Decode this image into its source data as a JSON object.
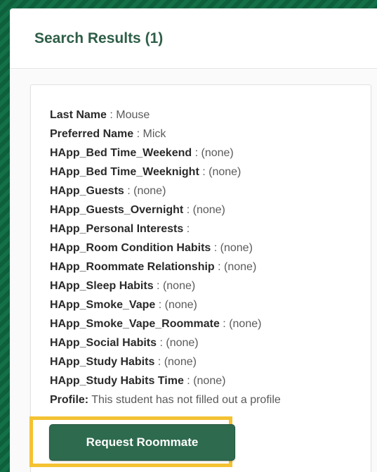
{
  "panel": {
    "title": "Search Results (1)"
  },
  "result": {
    "fields": [
      {
        "label": "Last Name",
        "sep": " : ",
        "value": "Mouse"
      },
      {
        "label": "Preferred Name",
        "sep": " : ",
        "value": "Mick"
      },
      {
        "label": "HApp_Bed Time_Weekend",
        "sep": " : ",
        "value": "(none)"
      },
      {
        "label": "HApp_Bed Time_Weeknight",
        "sep": " : ",
        "value": "(none)"
      },
      {
        "label": "HApp_Guests",
        "sep": " : ",
        "value": "(none)"
      },
      {
        "label": "HApp_Guests_Overnight",
        "sep": " : ",
        "value": "(none)"
      },
      {
        "label": "HApp_Personal Interests",
        "sep": " : ",
        "value": ""
      },
      {
        "label": "HApp_Room Condition Habits",
        "sep": " : ",
        "value": "(none)"
      },
      {
        "label": "HApp_Roommate Relationship",
        "sep": " : ",
        "value": "(none)"
      },
      {
        "label": "HApp_Sleep Habits",
        "sep": " : ",
        "value": "(none)"
      },
      {
        "label": "HApp_Smoke_Vape",
        "sep": " : ",
        "value": "(none)"
      },
      {
        "label": "HApp_Smoke_Vape_Roommate",
        "sep": " : ",
        "value": "(none)"
      },
      {
        "label": "HApp_Social Habits",
        "sep": " : ",
        "value": "(none)"
      },
      {
        "label": "HApp_Study Habits",
        "sep": " : ",
        "value": "(none)"
      },
      {
        "label": "HApp_Study Habits Time",
        "sep": " : ",
        "value": "(none)"
      },
      {
        "label": "Profile:",
        "sep": " ",
        "value": "This student has not filled out a profile"
      }
    ],
    "request_button_label": "Request Roommate"
  },
  "colors": {
    "brand_green": "#2e6a4e",
    "highlight": "#f4c232",
    "title_green": "#2e5e48"
  }
}
